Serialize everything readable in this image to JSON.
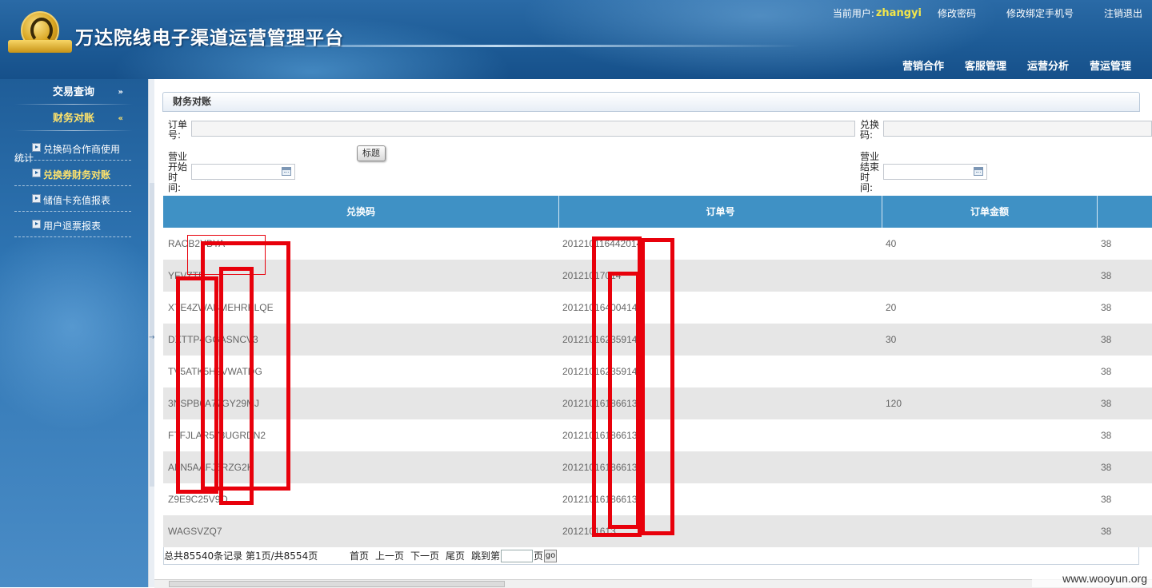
{
  "header": {
    "platform_title": "万达院线电子渠道运营管理平台",
    "current_user_label": "当前用户:",
    "username": "zhangyi",
    "links": [
      "修改密码",
      "修改绑定手机号",
      "注销退出"
    ],
    "main_nav": [
      "营销合作",
      "客服管理",
      "运营分析",
      "营运管理"
    ]
  },
  "sidebar": {
    "sections": [
      {
        "label": "交易查询",
        "chevron": "»",
        "active": false
      },
      {
        "label": "财务对账",
        "chevron": "«",
        "active": true
      }
    ],
    "items": [
      {
        "label": "兑换码合作商使用",
        "label_wrap": "统计",
        "active": false
      },
      {
        "label": "兑换券财务对账",
        "active": true
      },
      {
        "label": "储值卡充值报表",
        "active": false
      },
      {
        "label": "用户退票报表",
        "active": false
      }
    ]
  },
  "panel": {
    "title": "财务对账",
    "filters": {
      "order_no_label": "订单号:",
      "redeem_code_label": "兑换码:",
      "start_time_label": "营业开始时间:",
      "end_time_label": "营业结束时间:",
      "title_button": "标题"
    }
  },
  "table": {
    "columns": [
      "兑换码",
      "订单号",
      "订单金额",
      ""
    ],
    "rows": [
      {
        "code": "RACB2",
        "code_tail": "YBYA",
        "order": "20121",
        "order_mid": "01",
        "order_mid2": "16442",
        "order_tail": "014",
        "amount": "40",
        "extra": "38"
      },
      {
        "code": "Y",
        "code_mid": "FVZ",
        "code_tail": "TD",
        "order": "20121",
        "order_mid": "01",
        "order_mid2": "",
        "order_tail": "7014",
        "amount": "",
        "extra": "38"
      },
      {
        "code": "XTE4Z",
        "code_mid": "WA",
        "code_mid2": "BMEHR",
        "code_tail": "KLQE",
        "order": "20121",
        "order_mid": "01",
        "order_mid2": "640",
        "order_tail": "0414",
        "amount": "20",
        "extra": "38"
      },
      {
        "code": "D",
        "code_mid": "XTT",
        "code_mid2": "P4",
        "code_mid3": "GGA",
        "code_tail": "SNCV3",
        "order": "20121",
        "order_mid": "01",
        "order_mid2": "623",
        "order_tail": "5914",
        "amount": "30",
        "extra": "38"
      },
      {
        "code": "T",
        "code_mid": "V5AT",
        "code_mid2": "K5",
        "code_mid3": "H2VW",
        "code_tail": "A",
        "code_tail2": "TDG",
        "order": "20121",
        "order_mid": "01",
        "order_mid2": "623",
        "order_tail": "5914",
        "amount": "",
        "extra": "38"
      },
      {
        "code": "3",
        "code_mid": "NSP",
        "code_mid2": "B6",
        "code_mid3": "A77G",
        "code_tail": "Y2",
        "code_tail2": "9MJ",
        "order": "20121",
        "order_mid": "01",
        "order_mid2": "618",
        "order_tail": "6613",
        "amount": "120",
        "extra": "38"
      },
      {
        "code": "F",
        "code_mid": "TFJL",
        "code_mid2": "AR",
        "code_mid3": "573U",
        "code_tail": "GR",
        "code_tail2": "DN2",
        "order": "20121",
        "order_mid": "01",
        "order_mid2": "618",
        "order_tail": "6613",
        "amount": "",
        "extra": "38"
      },
      {
        "code": "A",
        "code_mid": "FN5",
        "code_mid2": "AA",
        "code_mid3": "FJ6R",
        "code_tail": "Z",
        "code_tail2": "G2K",
        "order": "20121",
        "order_mid": "01",
        "order_mid2": "618",
        "order_tail": "6613",
        "amount": "",
        "extra": "38"
      },
      {
        "code": "Z",
        "code_mid": "",
        "code_mid2": "",
        "code_mid3": "9E9C",
        "code_tail": "2",
        "code_tail2": "5V9Q",
        "order": "20121",
        "order_mid": "01",
        "order_mid2": "618",
        "order_tail": "6613",
        "amount": "",
        "extra": "38"
      },
      {
        "code": "WAGS",
        "code_mid": "",
        "code_mid2": "",
        "code_mid3": "",
        "code_tail": "",
        "code_tail2": "VZQ7",
        "order": "20121",
        "order_mid": "01",
        "order_mid2": "",
        "order_tail": "613",
        "amount": "",
        "extra": "38"
      }
    ]
  },
  "pager": {
    "summary": "总共85540条记录 第1页/共8554页",
    "first": "首页",
    "prev": "上一页",
    "next": "下一页",
    "last": "尾页",
    "jump_label": "跳到第",
    "page_unit": "页",
    "go": "go"
  },
  "watermark": "www.wooyun.org",
  "colors": {
    "header_bg": "#1d5b96",
    "table_header_bg": "#3f91c5",
    "username": "#f3e64a",
    "active_menu": "#ffe36b",
    "redaction": "#e8000b"
  }
}
